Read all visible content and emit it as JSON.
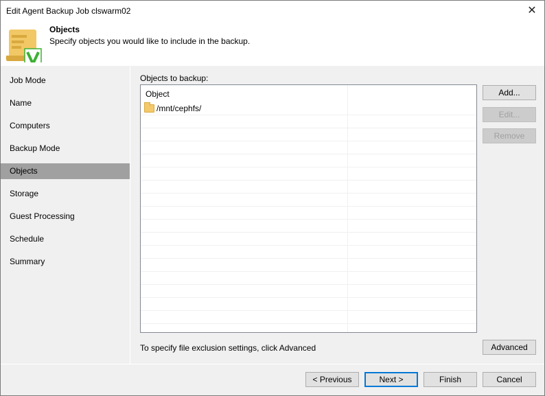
{
  "window": {
    "title": "Edit Agent Backup Job clswarm02",
    "close_icon": "close-icon"
  },
  "header": {
    "title": "Objects",
    "subtitle": "Specify objects you would like to include in the backup."
  },
  "sidebar": {
    "items": [
      {
        "label": "Job Mode"
      },
      {
        "label": "Name"
      },
      {
        "label": "Computers"
      },
      {
        "label": "Backup Mode"
      },
      {
        "label": "Objects",
        "selected": true
      },
      {
        "label": "Storage"
      },
      {
        "label": "Guest Processing"
      },
      {
        "label": "Schedule"
      },
      {
        "label": "Summary"
      }
    ]
  },
  "objects": {
    "label": "Objects to backup:",
    "column": "Object",
    "rows": [
      {
        "name": "/mnt/cephfs/",
        "icon": "folder-icon"
      }
    ]
  },
  "side_buttons": {
    "add": "Add...",
    "edit": "Edit...",
    "remove": "Remove"
  },
  "exclusion": {
    "hint": "To specify file exclusion settings, click Advanced",
    "advanced": "Advanced"
  },
  "footer": {
    "previous": "< Previous",
    "next": "Next >",
    "finish": "Finish",
    "cancel": "Cancel"
  },
  "colors": {
    "accent": "#0078d7",
    "selected_nav": "#a0a0a0",
    "check_green": "#3cb034"
  }
}
